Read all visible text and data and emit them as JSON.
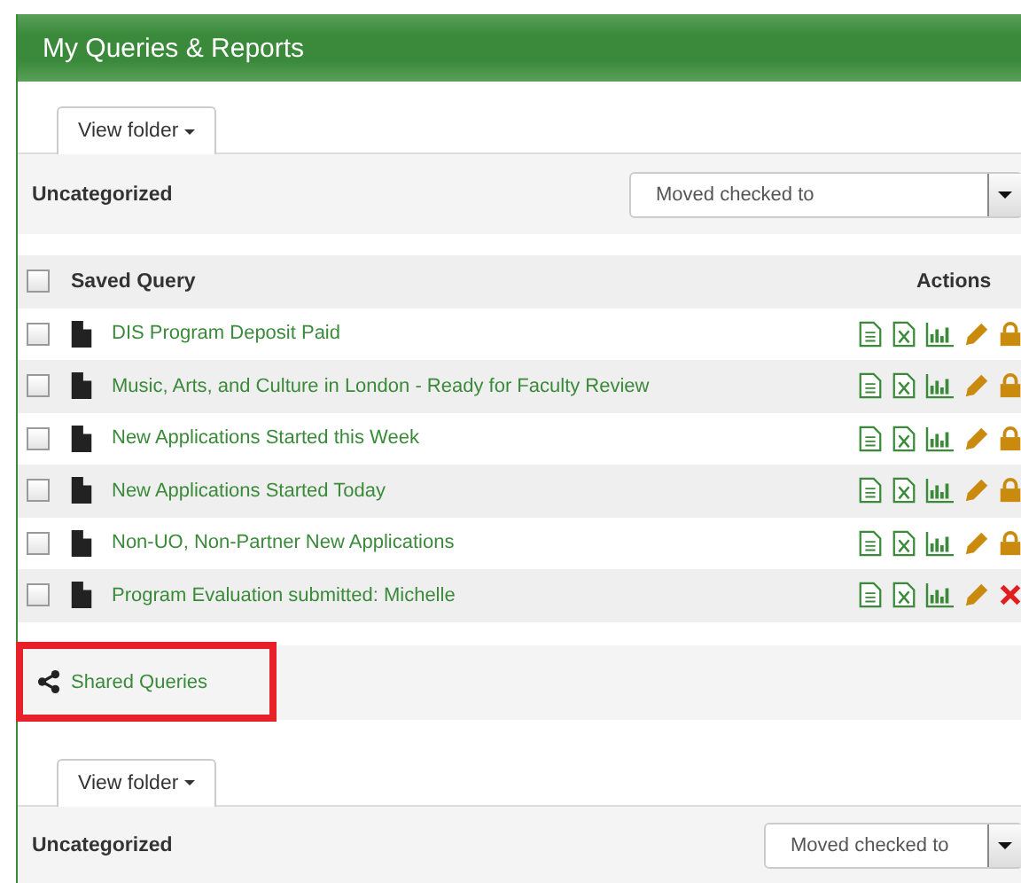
{
  "panel": {
    "title": "My Queries & Reports"
  },
  "folders": [
    {
      "view_folder": "View folder",
      "folder_name": "Uncategorized",
      "move_select": "Moved checked to",
      "table": {
        "header": {
          "checked": false,
          "name": "Saved Query",
          "actions": "Actions"
        },
        "rows": [
          {
            "checked": false,
            "name": "DIS Program Deposit Paid",
            "actions": [
              {
                "kind": "report"
              },
              {
                "kind": "excel"
              },
              {
                "kind": "chart"
              },
              {
                "kind": "edit"
              },
              {
                "kind": "lock"
              }
            ]
          },
          {
            "checked": false,
            "name": "Music, Arts, and Culture in London - Ready for Faculty Review",
            "actions": [
              {
                "kind": "report"
              },
              {
                "kind": "excel"
              },
              {
                "kind": "chart"
              },
              {
                "kind": "edit"
              },
              {
                "kind": "lock"
              }
            ]
          },
          {
            "checked": false,
            "name": "New Applications Started this Week",
            "actions": [
              {
                "kind": "report"
              },
              {
                "kind": "excel"
              },
              {
                "kind": "chart"
              },
              {
                "kind": "edit"
              },
              {
                "kind": "lock"
              }
            ]
          },
          {
            "checked": false,
            "name": "New Applications Started Today",
            "actions": [
              {
                "kind": "report"
              },
              {
                "kind": "excel"
              },
              {
                "kind": "chart"
              },
              {
                "kind": "edit"
              },
              {
                "kind": "lock"
              }
            ]
          },
          {
            "checked": false,
            "name": "Non-UO, Non-Partner New Applications",
            "actions": [
              {
                "kind": "report"
              },
              {
                "kind": "excel"
              },
              {
                "kind": "chart"
              },
              {
                "kind": "edit"
              },
              {
                "kind": "lock"
              }
            ]
          },
          {
            "checked": false,
            "name": "Program Evaluation submitted: Michelle",
            "actions": [
              {
                "kind": "report"
              },
              {
                "kind": "excel"
              },
              {
                "kind": "chart"
              },
              {
                "kind": "edit"
              },
              {
                "kind": "delete"
              }
            ]
          }
        ]
      }
    }
  ],
  "shared": {
    "label": "Shared Queries",
    "highlighted": true
  },
  "shared_folder": {
    "view_folder": "View folder",
    "folder_name": "Uncategorized",
    "move_select": "Moved checked to"
  }
}
